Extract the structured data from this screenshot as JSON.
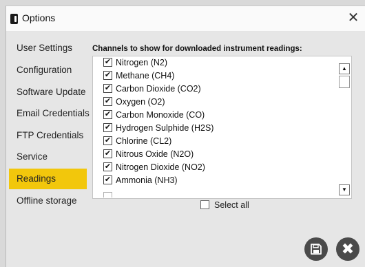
{
  "window": {
    "title": "Options"
  },
  "sidebar": {
    "items": [
      {
        "label": "User Settings",
        "active": false
      },
      {
        "label": "Configuration",
        "active": false
      },
      {
        "label": "Software Update",
        "active": false
      },
      {
        "label": "Email Credentials",
        "active": false
      },
      {
        "label": "FTP Credentials",
        "active": false
      },
      {
        "label": "Service",
        "active": false
      },
      {
        "label": "Readings",
        "active": true
      },
      {
        "label": "Offline storage",
        "active": false
      }
    ]
  },
  "main": {
    "section_label": "Channels to show for downloaded instrument readings:",
    "channels": [
      {
        "label": "Nitrogen (N2)",
        "checked": true
      },
      {
        "label": "Methane (CH4)",
        "checked": true
      },
      {
        "label": "Carbon Dioxide (CO2)",
        "checked": true
      },
      {
        "label": "Oxygen (O2)",
        "checked": true
      },
      {
        "label": "Carbon Monoxide (CO)",
        "checked": true
      },
      {
        "label": "Hydrogen Sulphide (H2S)",
        "checked": true
      },
      {
        "label": "Chlorine (CL2)",
        "checked": true
      },
      {
        "label": "Nitrous Oxide (N2O)",
        "checked": true
      },
      {
        "label": "Nitrogen Dioxide (NO2)",
        "checked": true
      },
      {
        "label": "Ammonia (NH3)",
        "checked": true
      }
    ],
    "select_all": {
      "label": "Select all",
      "checked": false
    }
  },
  "icons": {
    "checkmark": "✔",
    "scroll_up": "▲",
    "scroll_down": "▼",
    "close": "✕",
    "dialog_close": "✖"
  },
  "colors": {
    "active_nav": "#f2c70c",
    "background": "#e6e6e6",
    "round_button": "#4a4a4a"
  }
}
